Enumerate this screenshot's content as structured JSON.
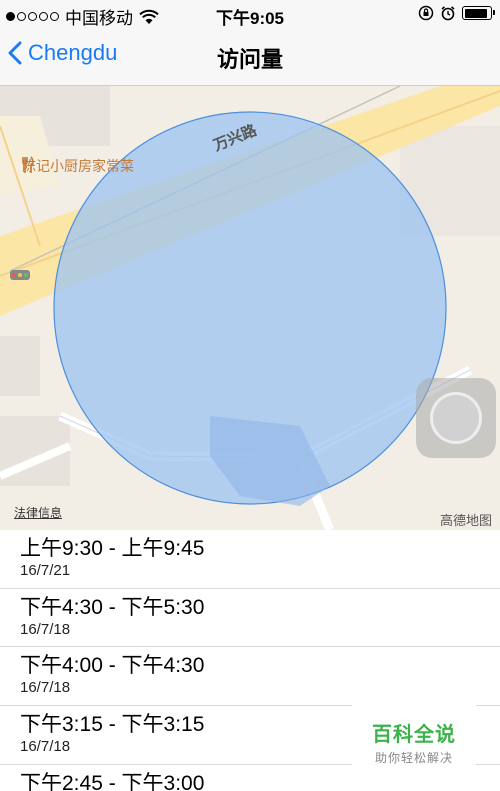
{
  "status_bar": {
    "carrier": "中国移动",
    "time": "下午9:05",
    "signal_dots_filled": 1,
    "signal_dots_total": 5
  },
  "nav": {
    "back_label": "Chengdu",
    "title": "访问量"
  },
  "map": {
    "poi": "陈记小厨房家常菜",
    "road": "万兴路",
    "legal_link": "法律信息",
    "brand": "高德地图",
    "circle_color": "#9cc3f0"
  },
  "visits": [
    {
      "range": "上午9:30 - 上午9:45",
      "date": "16/7/21"
    },
    {
      "range": "下午4:30 - 下午5:30",
      "date": "16/7/18"
    },
    {
      "range": "下午4:00 - 下午4:30",
      "date": "16/7/18"
    },
    {
      "range": "下午3:15 - 下午3:15",
      "date": "16/7/18"
    },
    {
      "range": "下午2:45 - 下午3:00",
      "date": ""
    }
  ],
  "watermark": {
    "title": "百科全说",
    "subtitle": "助你轻松解决"
  },
  "colors": {
    "accent": "#1a7bf2",
    "map_bg": "#f2eee6"
  }
}
